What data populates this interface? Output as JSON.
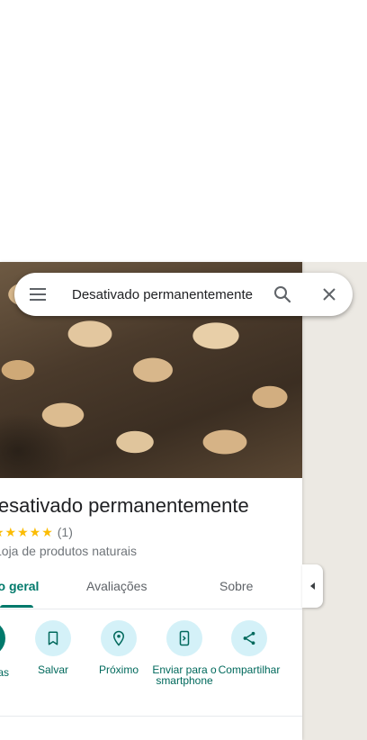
{
  "search": {
    "value": "Desativado permanentemente"
  },
  "place": {
    "title": "Desativado permanentemente",
    "stars": "★★★★★",
    "rating_count": "(1)",
    "category": "Loja de produtos naturais"
  },
  "tabs": [
    {
      "label": "Visão geral"
    },
    {
      "label": "Avaliações"
    },
    {
      "label": "Sobre"
    }
  ],
  "actions": {
    "partial_label": "Rotas",
    "items": [
      {
        "label": "Salvar",
        "icon": "bookmark-icon"
      },
      {
        "label": "Próximo",
        "icon": "nearby-icon"
      },
      {
        "label": "Enviar para o smartphone",
        "icon": "send-to-phone-icon"
      },
      {
        "label": "Compartilhar",
        "icon": "share-icon"
      }
    ]
  },
  "colors": {
    "accent": "#00796b",
    "action_bg": "#d4f1f8",
    "star": "#fbbc04"
  }
}
